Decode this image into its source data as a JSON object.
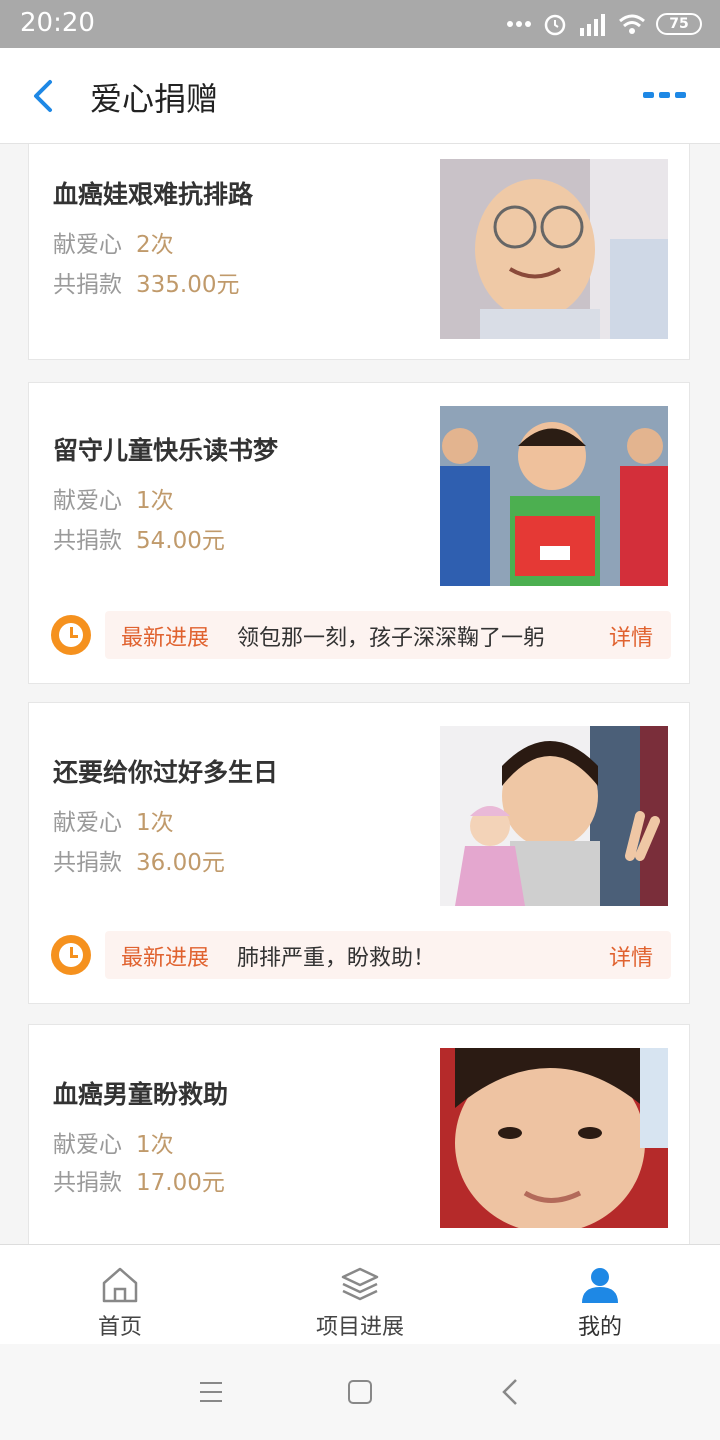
{
  "status_bar": {
    "time": "20:20",
    "battery": "75"
  },
  "nav": {
    "title": "爱心捐赠"
  },
  "cards": [
    {
      "title": "血癌娃艰难抗排路",
      "love_label": "献爱心",
      "love_value": "2次",
      "donate_label": "共捐款",
      "donate_value": "335.00元"
    },
    {
      "title": "留守儿童快乐读书梦",
      "love_label": "献爱心",
      "love_value": "1次",
      "donate_label": "共捐款",
      "donate_value": "54.00元",
      "progress_label": "最新进展",
      "progress_text": "领包那一刻，孩子深深鞠了一躬",
      "progress_link": "详情"
    },
    {
      "title": "还要给你过好多生日",
      "love_label": "献爱心",
      "love_value": "1次",
      "donate_label": "共捐款",
      "donate_value": "36.00元",
      "progress_label": "最新进展",
      "progress_text": "肺排严重，盼救助！",
      "progress_link": "详情"
    },
    {
      "title": "血癌男童盼救助",
      "love_label": "献爱心",
      "love_value": "1次",
      "donate_label": "共捐款",
      "donate_value": "17.00元"
    }
  ],
  "tabs": [
    {
      "label": "首页",
      "icon": "home-icon"
    },
    {
      "label": "项目进展",
      "icon": "layers-icon"
    },
    {
      "label": "我的",
      "icon": "user-icon",
      "active": true
    }
  ],
  "colors": {
    "accent_blue": "#1e88e5",
    "value_gold": "#c09a6b",
    "progress_orange": "#e0622f",
    "clock_orange": "#f5911e"
  }
}
